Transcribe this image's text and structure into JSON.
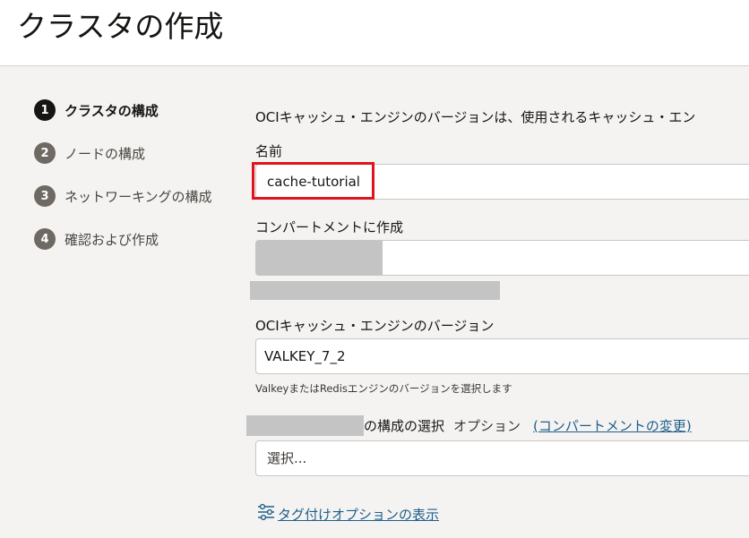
{
  "header": {
    "title": "クラスタの作成"
  },
  "steps": [
    {
      "number": "1",
      "label": "クラスタの構成",
      "active": true
    },
    {
      "number": "2",
      "label": "ノードの構成",
      "active": false
    },
    {
      "number": "3",
      "label": "ネットワーキングの構成",
      "active": false
    },
    {
      "number": "4",
      "label": "確認および作成",
      "active": false
    }
  ],
  "form": {
    "intro_text": "OCIキャッシュ・エンジンのバージョンは、使用されるキャッシュ・エン",
    "name_label": "名前",
    "name_value": "cache-tutorial",
    "compartment_label": "コンパートメントに作成",
    "engine_label": "OCIキャッシュ・エンジンのバージョン",
    "engine_value": "VALKEY_7_2",
    "engine_helper": "ValkeyまたはRedisエンジンのバージョンを選択します",
    "config_label": "の構成の選択",
    "config_optional": "オプション",
    "config_change_link": "(コンパートメントの変更)",
    "config_placeholder": "選択...",
    "tag_options_link": "タグ付けオプションの表示"
  },
  "colors": {
    "highlight": "#e0141e",
    "link": "#1e5f8c",
    "active_step": "#161513",
    "inactive_step": "#6f6964"
  }
}
